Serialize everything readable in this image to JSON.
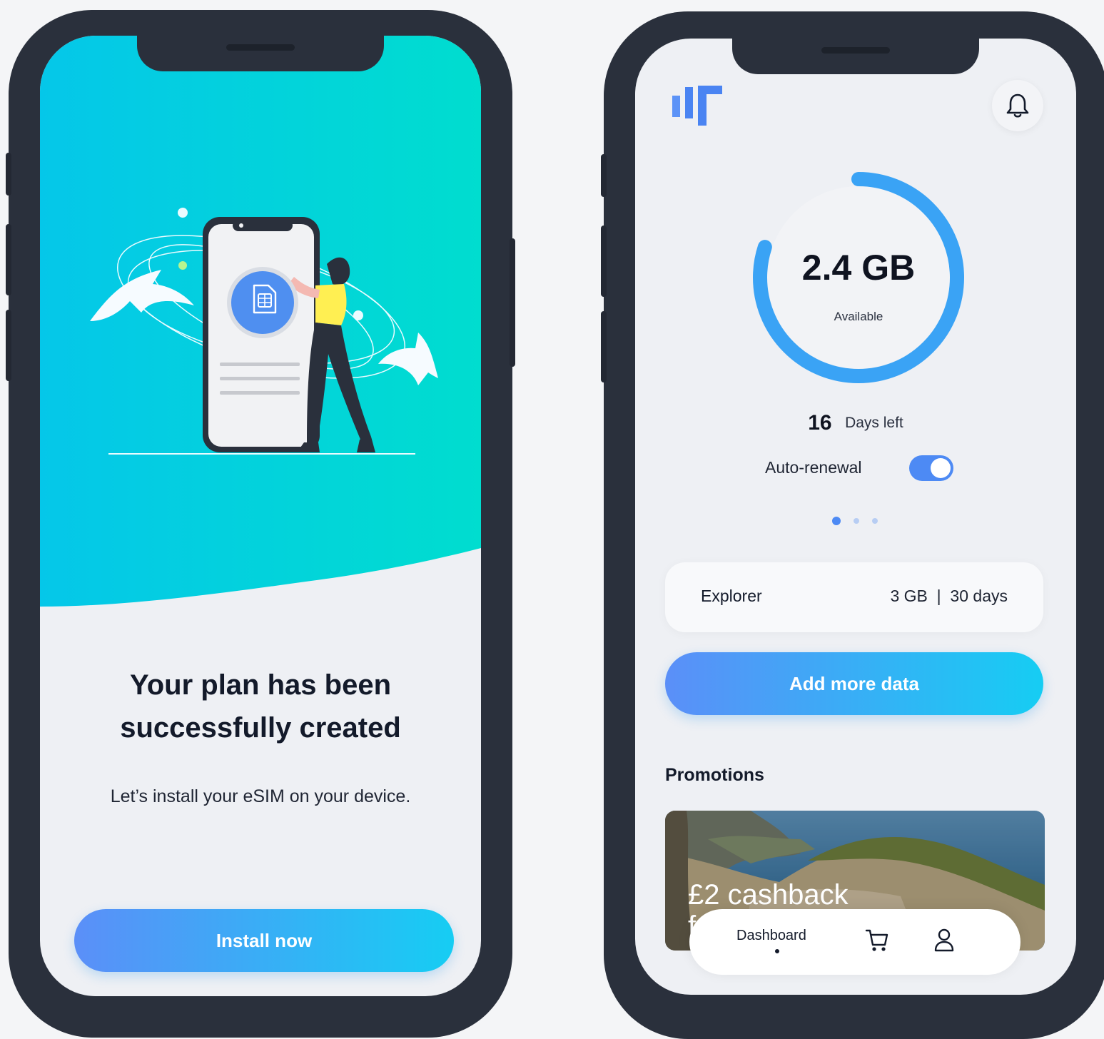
{
  "left_screen": {
    "success_title_line1": "Your plan has been",
    "success_title_line2": "successfully created",
    "success_subtitle": "Let’s install your eSIM on your device.",
    "install_button_label": "Install now",
    "illustration_icon": "sim-card-icon"
  },
  "right_screen": {
    "logo_icon": "brand-logo-icon",
    "notification_icon": "bell-icon",
    "data_available_value": "2.4 GB",
    "data_available_label": "Available",
    "data_remaining_fraction": 0.8,
    "days_left_number": "16",
    "days_left_label": "Days left",
    "auto_renewal_label": "Auto-renewal",
    "auto_renewal_enabled": true,
    "pagination": {
      "count": 3,
      "active_index": 0
    },
    "plan": {
      "name": "Explorer",
      "details": "3 GB  |  30 days"
    },
    "add_data_button_label": "Add more data",
    "promotions_heading": "Promotions",
    "promo_card_text": "£2 cashback",
    "promo_card_text_partial": "f",
    "bottom_nav": {
      "dashboard_label": "Dashboard",
      "cart_icon": "cart-icon",
      "profile_icon": "user-icon"
    }
  },
  "colors": {
    "accent_blue": "#4d8af4",
    "accent_cyan": "#16cdf3",
    "hero_teal": "#00d9d2",
    "dark_text": "#131a2a",
    "phone_frame": "#2a303c"
  }
}
